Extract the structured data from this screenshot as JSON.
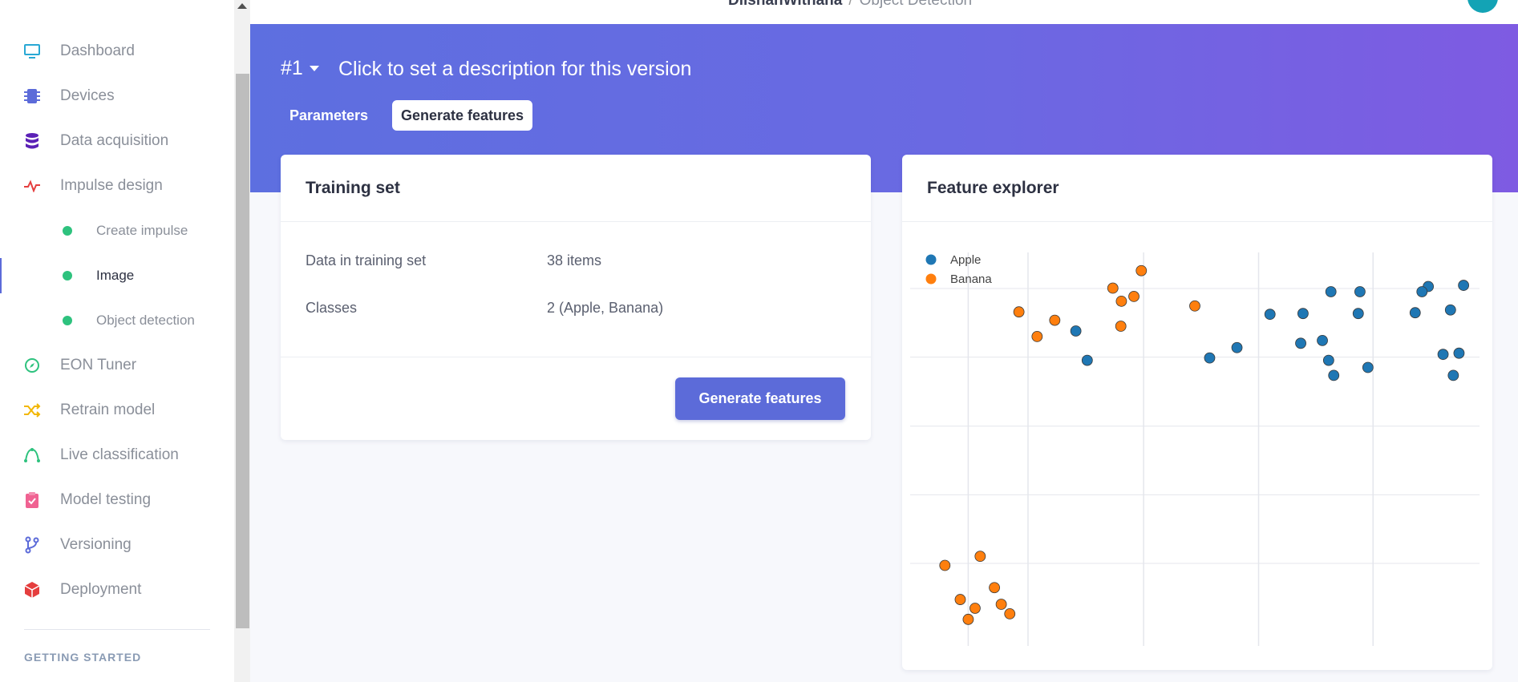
{
  "sidebar": {
    "items": [
      {
        "label": "Dashboard",
        "icon": "monitor-icon",
        "color": "#29a8d4"
      },
      {
        "label": "Devices",
        "icon": "chip-icon",
        "color": "#5c6bd9"
      },
      {
        "label": "Data acquisition",
        "icon": "database-icon",
        "color": "#5b21b6"
      },
      {
        "label": "Impulse design",
        "icon": "pulse-icon",
        "color": "#e53e3e"
      },
      {
        "label": "EON Tuner",
        "icon": "compass-icon",
        "color": "#2ec27e"
      },
      {
        "label": "Retrain model",
        "icon": "shuffle-icon",
        "color": "#f2b705"
      },
      {
        "label": "Live classification",
        "icon": "bezier-icon",
        "color": "#2ec27e"
      },
      {
        "label": "Model testing",
        "icon": "clipboard-check-icon",
        "color": "#f06292"
      },
      {
        "label": "Versioning",
        "icon": "branch-icon",
        "color": "#5c6bd9"
      },
      {
        "label": "Deployment",
        "icon": "box-icon",
        "color": "#e53e3e"
      }
    ],
    "sub_items": [
      {
        "label": "Create impulse"
      },
      {
        "label": "Image",
        "active": true
      },
      {
        "label": "Object detection"
      }
    ],
    "section_heading": "GETTING STARTED"
  },
  "header": {
    "project": "DilshanWithana",
    "separator": "/",
    "page": "Object Detection"
  },
  "version": {
    "label": "#1",
    "description": "Click to set a description for this version"
  },
  "tabs": [
    {
      "label": "Parameters",
      "active": false
    },
    {
      "label": "Generate features",
      "active": true
    }
  ],
  "training_set": {
    "title": "Training set",
    "rows": [
      {
        "label": "Data in training set",
        "value": "38 items"
      },
      {
        "label": "Classes",
        "value": "2 (Apple, Banana)"
      }
    ],
    "button_label": "Generate features"
  },
  "feature_explorer": {
    "title": "Feature explorer"
  },
  "chart_data": {
    "type": "scatter",
    "title": "",
    "xlabel": "",
    "ylabel": "",
    "xlim": [
      0,
      100
    ],
    "ylim": [
      0,
      100
    ],
    "grid": true,
    "legend": "top-left",
    "series": [
      {
        "name": "Apple",
        "color": "#1f77b4",
        "points": [
          [
            29.1,
            79.4
          ],
          [
            31.1,
            72.0
          ],
          [
            52.6,
            72.6
          ],
          [
            57.4,
            75.2
          ],
          [
            63.2,
            83.6
          ],
          [
            69.0,
            83.8
          ],
          [
            73.9,
            89.3
          ],
          [
            79.0,
            89.3
          ],
          [
            91.0,
            90.6
          ],
          [
            94.9,
            84.7
          ],
          [
            68.6,
            76.3
          ],
          [
            72.4,
            77.0
          ],
          [
            73.5,
            72.0
          ],
          [
            74.4,
            68.2
          ],
          [
            80.4,
            70.2
          ],
          [
            88.7,
            84.0
          ],
          [
            89.9,
            89.3
          ],
          [
            78.7,
            83.8
          ],
          [
            93.6,
            73.5
          ],
          [
            97.2,
            90.9
          ],
          [
            96.4,
            73.8
          ],
          [
            95.4,
            68.2
          ]
        ]
      },
      {
        "name": "Banana",
        "color": "#ff7f0e",
        "points": [
          [
            19.1,
            84.2
          ],
          [
            22.3,
            78.0
          ],
          [
            25.4,
            82.1
          ],
          [
            35.6,
            90.2
          ],
          [
            37.1,
            86.9
          ],
          [
            39.3,
            88.1
          ],
          [
            40.6,
            94.6
          ],
          [
            50.0,
            85.7
          ],
          [
            37.0,
            80.6
          ],
          [
            6.1,
            20.3
          ],
          [
            12.3,
            22.6
          ],
          [
            8.8,
            11.7
          ],
          [
            11.4,
            9.5
          ],
          [
            14.8,
            14.7
          ],
          [
            16.0,
            10.5
          ],
          [
            17.5,
            8.1
          ],
          [
            10.2,
            6.7
          ]
        ]
      }
    ]
  }
}
